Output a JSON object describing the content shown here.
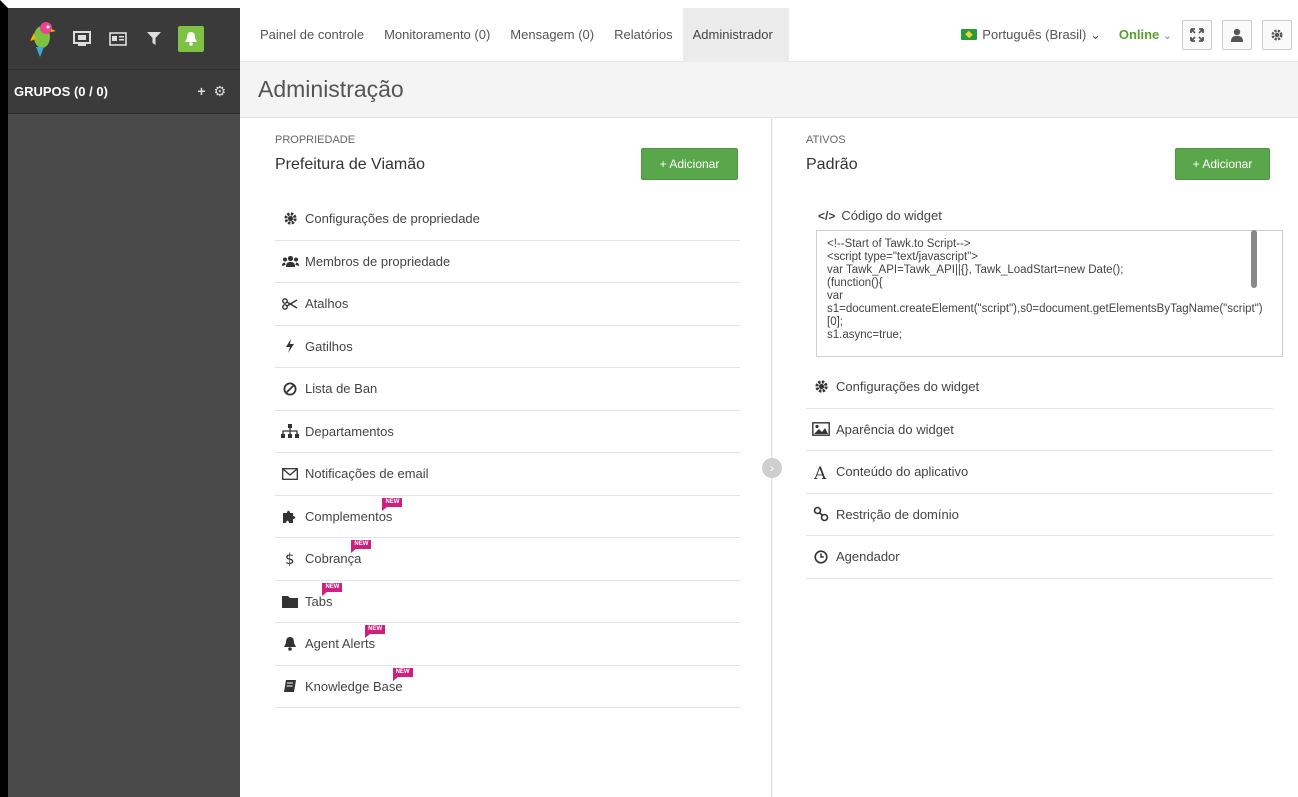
{
  "sidebar": {
    "group_label": "GRUPOS (0 / 0)",
    "actions": "+ ⚙"
  },
  "nav": {
    "items": [
      "Painel de controle",
      "Monitoramento (0)",
      "Mensagem (0)",
      "Relatórios",
      "Administrador"
    ],
    "language": "Português (Brasil) ⌄",
    "status": "Online",
    "status_caret": "⌄"
  },
  "page": {
    "title": "Administração"
  },
  "left": {
    "label": "PROPRIEDADE",
    "title": "Prefeitura de Viamão",
    "add_label": "+ Adicionar",
    "items": [
      {
        "label": "Configurações de propriedade",
        "icon": "gear-icon"
      },
      {
        "label": "Membros de propriedade",
        "icon": "users-icon"
      },
      {
        "label": "Atalhos",
        "icon": "scissors-icon"
      },
      {
        "label": "Gatilhos",
        "icon": "bolt-icon"
      },
      {
        "label": "Lista de Ban",
        "icon": "ban-icon"
      },
      {
        "label": "Departamentos",
        "icon": "sitemap-icon"
      },
      {
        "label": "Notificações de email",
        "icon": "envelope-icon"
      },
      {
        "label": "Complementos",
        "icon": "puzzle-icon",
        "new": true
      },
      {
        "label": "Cobrança",
        "icon": "dollar-icon",
        "new": true
      },
      {
        "label": "Tabs",
        "icon": "folder-icon",
        "new": true
      },
      {
        "label": "Agent Alerts",
        "icon": "bell-icon",
        "new": true
      },
      {
        "label": "Knowledge Base",
        "icon": "book-icon",
        "new": true
      }
    ],
    "new_badge": "NEW"
  },
  "right": {
    "label": "ATIVOS",
    "title": "Padrão",
    "add_label": "+ Adicionar",
    "widget_code_label": "Código do widget",
    "code": "<!--Start of Tawk.to Script-->\n<script type=\"text/javascript\">\nvar Tawk_API=Tawk_API||{}, Tawk_LoadStart=new Date();\n(function(){\nvar\ns1=document.createElement(\"script\"),s0=document.getElementsByTagName(\"script\")[0];\ns1.async=true;",
    "items": [
      {
        "label": "Configurações do widget",
        "icon": "gear-icon"
      },
      {
        "label": "Aparência do widget",
        "icon": "image-icon"
      },
      {
        "label": "Conteúdo do aplicativo",
        "icon": "font-icon"
      },
      {
        "label": "Restrição de domínio",
        "icon": "link-icon"
      },
      {
        "label": "Agendador",
        "icon": "clock-icon"
      }
    ]
  },
  "colors": {
    "accent": "#5aa64a",
    "online": "#58a12f",
    "badge": "#d0207e",
    "sidebar": "#4a4a4a"
  }
}
